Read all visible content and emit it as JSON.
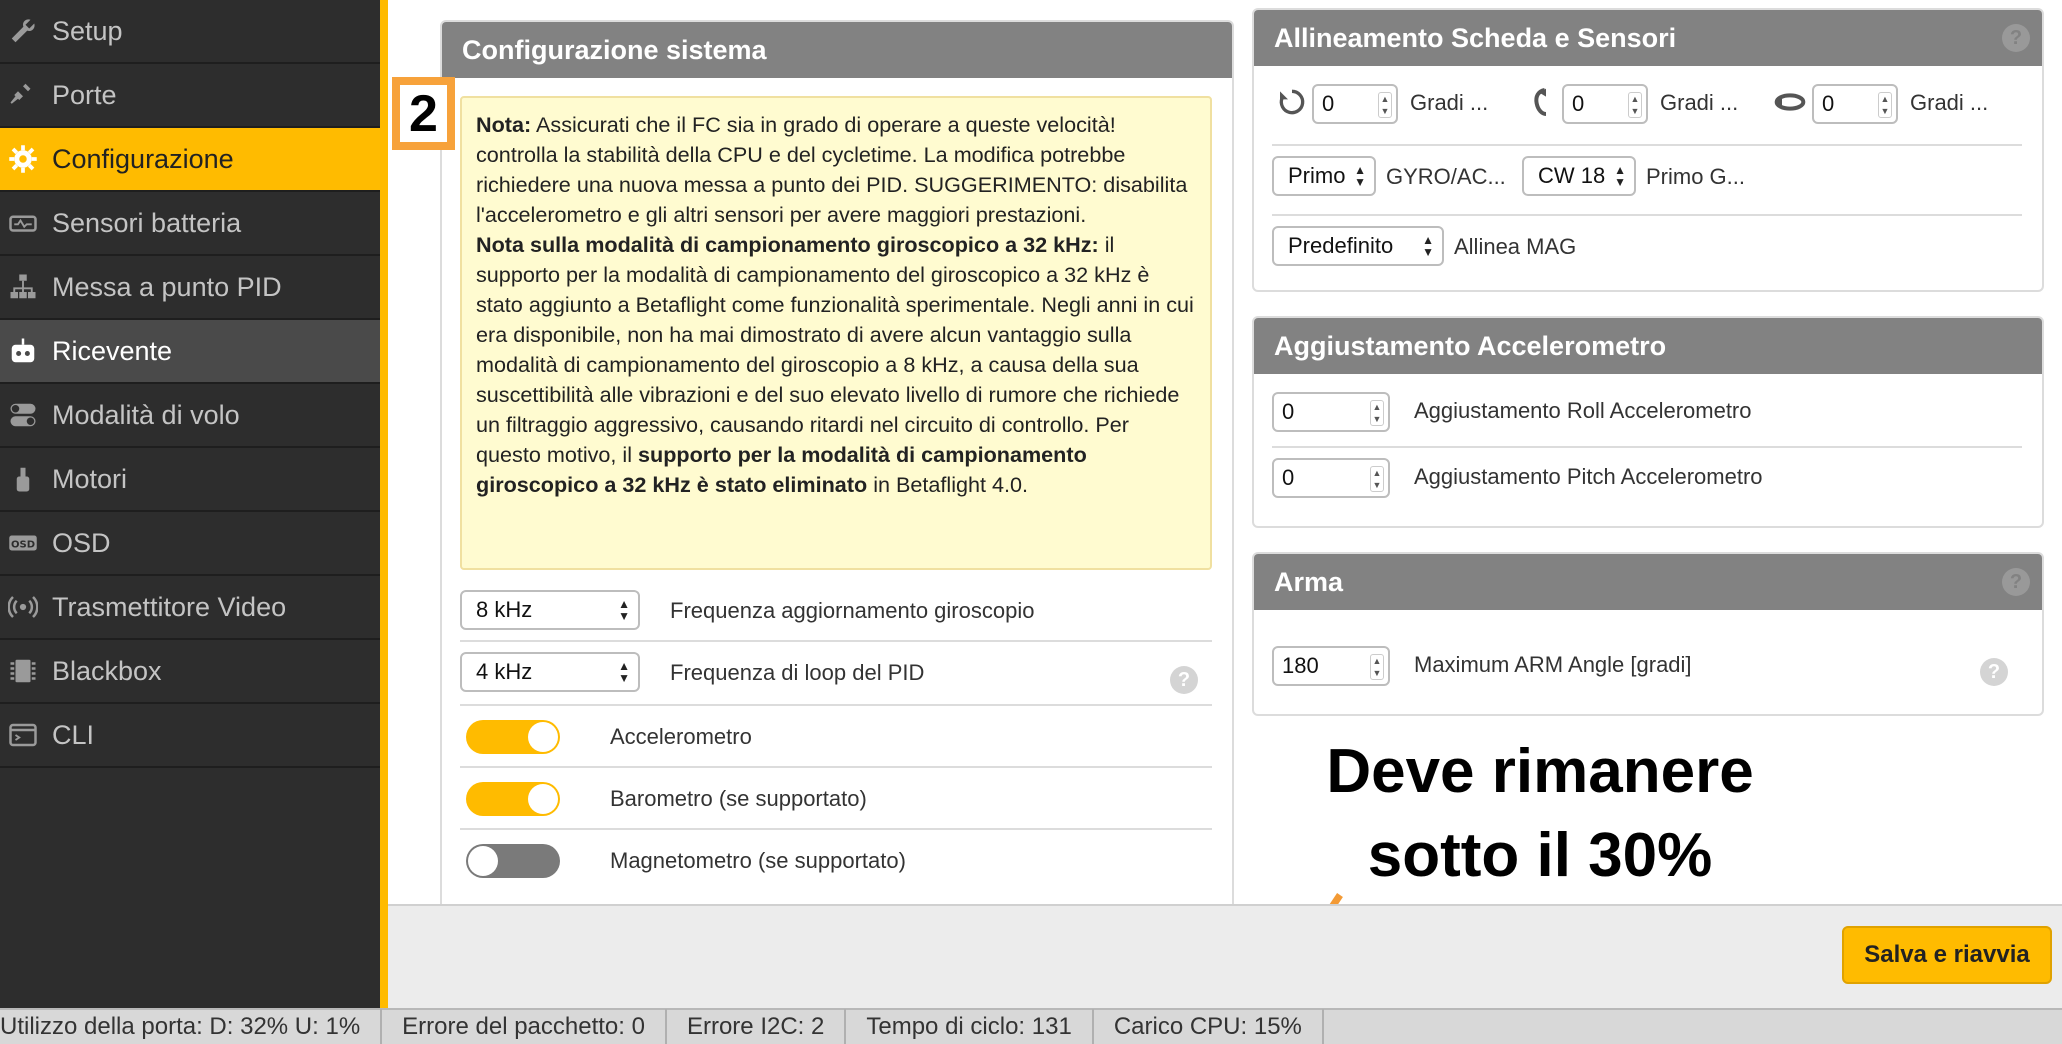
{
  "sidebar": {
    "items": [
      {
        "label": "Setup",
        "icon": "wrench-icon"
      },
      {
        "label": "Porte",
        "icon": "plug-icon"
      },
      {
        "label": "Configurazione",
        "icon": "gear-icon"
      },
      {
        "label": "Sensori batteria",
        "icon": "battery-icon"
      },
      {
        "label": "Messa a punto PID",
        "icon": "sitemap-icon"
      },
      {
        "label": "Ricevente",
        "icon": "robot-icon"
      },
      {
        "label": "Modalità di volo",
        "icon": "switches-icon"
      },
      {
        "label": "Motori",
        "icon": "motor-icon"
      },
      {
        "label": "OSD",
        "icon": "osd-icon"
      },
      {
        "label": "Trasmettitore Video",
        "icon": "broadcast-icon"
      },
      {
        "label": "Blackbox",
        "icon": "blackbox-icon"
      },
      {
        "label": "CLI",
        "icon": "terminal-icon"
      }
    ],
    "active_index": 2,
    "hover_index": 5
  },
  "system_config": {
    "title": "Configurazione sistema",
    "step_badge": "2",
    "note": {
      "p1_bold": "Nota:",
      "p1_text": " Assicurati che il FC sia in grado di operare a queste velocità! controlla la stabilità della CPU e del cycletime. La modifica potrebbe richiedere una nuova messa a punto dei PID. SUGGERIMENTO: disabilita l'accelerometro e gli altri sensori per avere maggiori prestazioni.",
      "p2_bold": "Nota sulla modalità di campionamento giroscopico a 32 kHz:",
      "p2_text": " il supporto per la modalità di campionamento del giroscopico a 32 kHz è stato aggiunto a Betaflight come funzionalità sperimentale. Negli anni in cui era disponibile, non ha mai dimostrato di avere alcun vantaggio sulla modalità di campionamento del giroscopio a 8 kHz, a causa della sua suscettibilità alle vibrazioni e del suo elevato livello di rumore che richiede un filtraggio aggressivo, causando ritardi nel circuito di controllo. Per questo motivo, il ",
      "p2_bold2": "supporto per la modalità di campionamento giroscopico a 32 kHz è stato eliminato",
      "p2_text2": " in Betaflight 4.0."
    },
    "gyro_freq_value": "8 kHz",
    "gyro_freq_label": "Frequenza aggiornamento giroscopio",
    "pid_loop_value": "4 kHz",
    "pid_loop_label": "Frequenza di loop del PID",
    "accel_label": "Accelerometro",
    "accel_on": true,
    "baro_label": "Barometro (se supportato)",
    "baro_on": true,
    "mag_label": "Magnetometro (se supportato)",
    "mag_on": false
  },
  "alignment": {
    "title": "Allineamento Scheda e Sensori",
    "roll_value": "0",
    "roll_label": "Gradi ...",
    "pitch_value": "0",
    "pitch_label": "Gradi ...",
    "yaw_value": "0",
    "yaw_label": "Gradi ...",
    "gyro_select": "Primo",
    "gyro_label": "GYRO/AC...",
    "cw_select": "CW 18",
    "cw_label": "Primo G...",
    "mag_select": "Predefinito",
    "mag_label": "Allinea MAG"
  },
  "accel_trim": {
    "title": "Aggiustamento Accelerometro",
    "roll_value": "0",
    "roll_label": "Aggiustamento Roll Accelerometro",
    "pitch_value": "0",
    "pitch_label": "Aggiustamento Pitch Accelerometro"
  },
  "arm": {
    "title": "Arma",
    "angle_value": "180",
    "angle_label": "Maximum ARM Angle [gradi]"
  },
  "annotation": {
    "line1": "Deve rimanere",
    "line2": "sotto il 30%",
    "arrow_color": "#f39a35"
  },
  "save_button": "Salva e riavvia",
  "status_bar": [
    "Utilizzo della porta: D: 32% U: 1%",
    "Errore del pacchetto: 0",
    "Errore I2C: 2",
    "Tempo di ciclo: 131",
    "Carico CPU: 15%"
  ],
  "colors": {
    "accent": "#ffbb00",
    "sidebar_bg": "#2d2d2d",
    "panel_header": "#828282",
    "note_bg": "#fffbd0",
    "badge": "#f7a23b"
  }
}
